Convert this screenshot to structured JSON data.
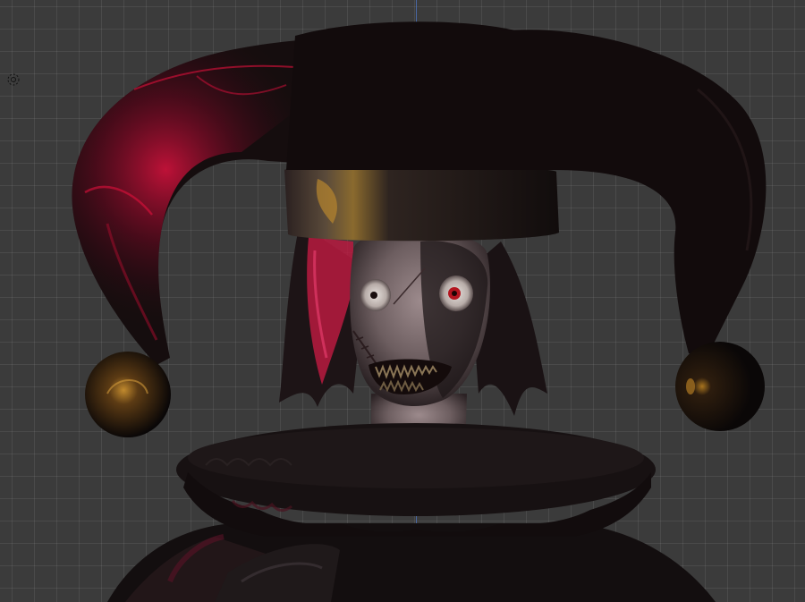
{
  "viewport": {
    "background_color": "#3b3b3b",
    "grid_color": "rgba(255,255,255,0.075)",
    "axis_color": "#4f77c7"
  },
  "model": {
    "hat_color": "#150d0e",
    "hat_glow_color": "#d0123c",
    "band_gold_color": "#b8862e",
    "skin_color": "#8e7d80",
    "hair_color": "#1d1416",
    "hair_red_color": "#b81a3f",
    "ruff_color": "#171112",
    "eye_iris_color": "#b3151f"
  },
  "icons": {
    "light": "sun-lamp-icon"
  }
}
